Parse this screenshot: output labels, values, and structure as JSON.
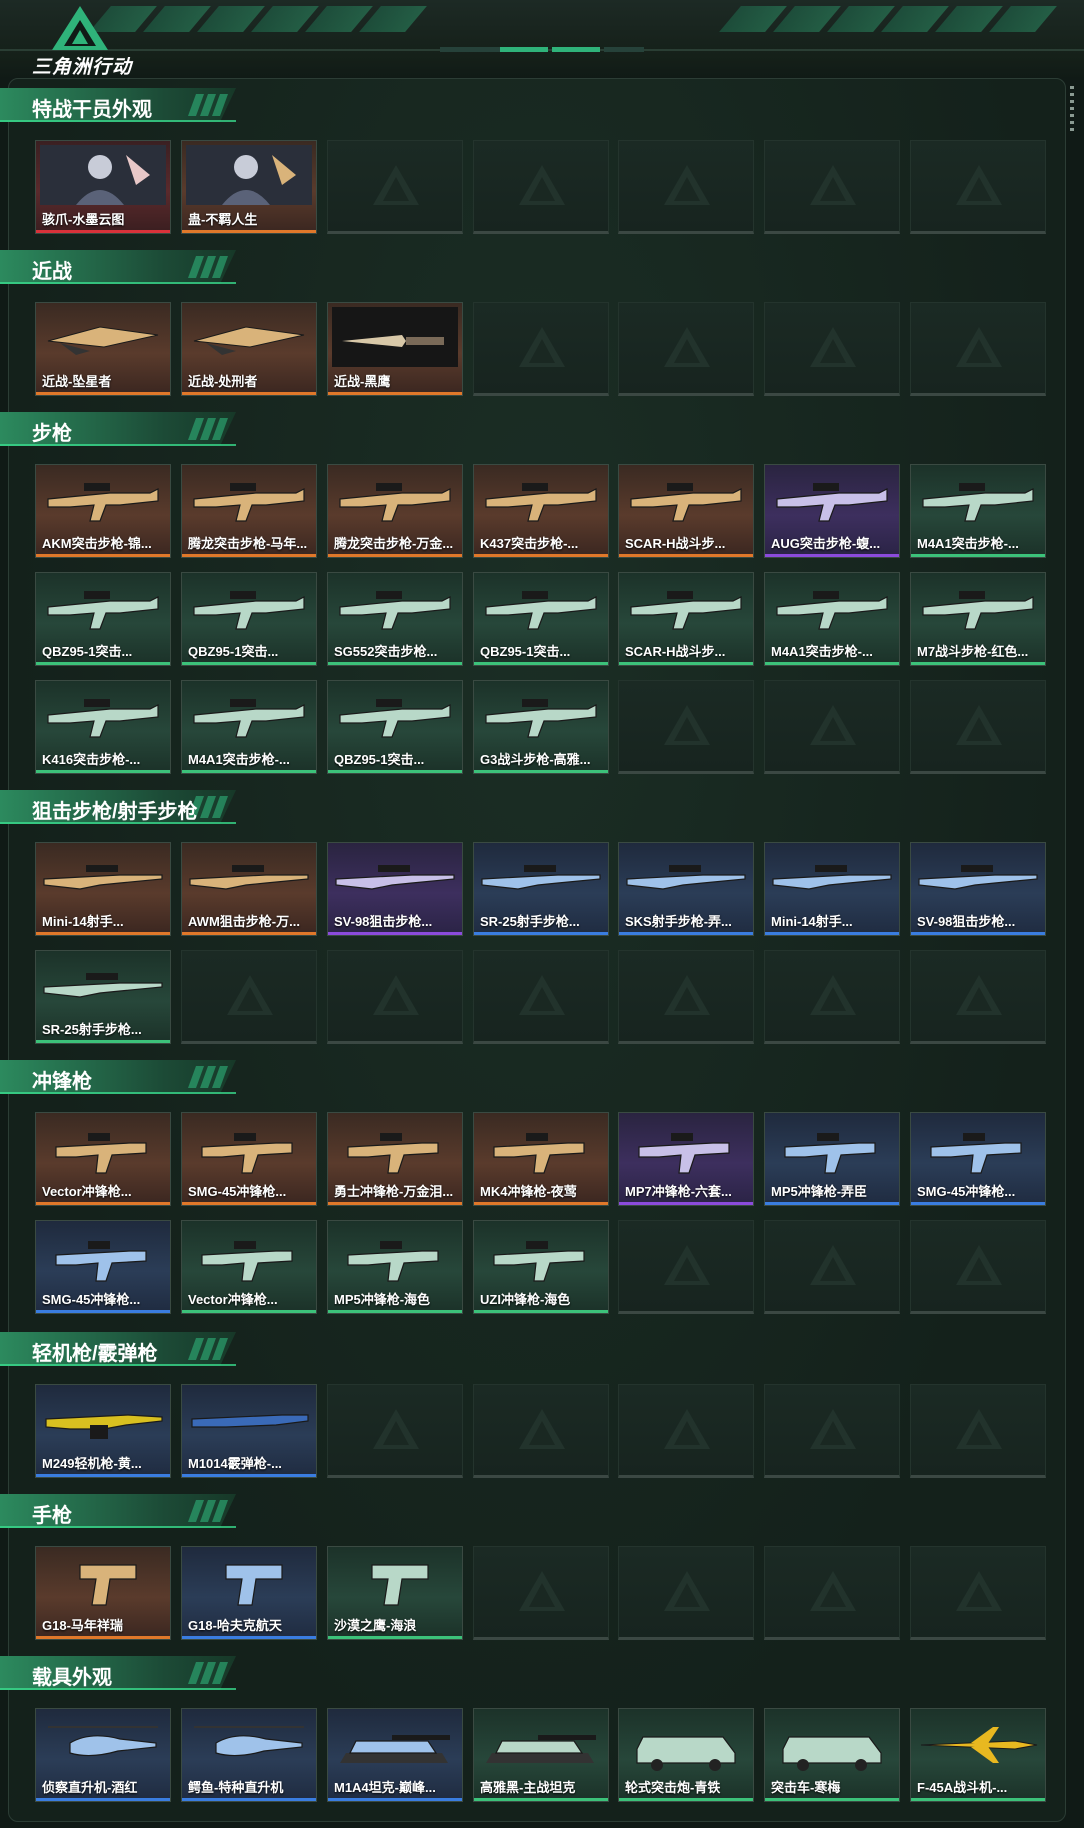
{
  "app": {
    "logo_text": "三角洲行动"
  },
  "colors": {
    "accent": "#2fb37a",
    "orange": "#e0782a",
    "purple": "#8b4bdc",
    "blue": "#3a7de0",
    "green": "#3cc27a",
    "red": "#d8323a"
  },
  "sections": [
    {
      "title": "特战干员外观",
      "items": [
        {
          "label": "骇爪-水墨云图",
          "rarity": "red",
          "icon": "operator-portrait"
        },
        {
          "label": "蛊-不羁人生",
          "rarity": "orange",
          "icon": "operator-portrait"
        }
      ]
    },
    {
      "title": "近战",
      "items": [
        {
          "label": "近战-坠星者",
          "rarity": "orange",
          "icon": "melee-blade"
        },
        {
          "label": "近战-处刑者",
          "rarity": "orange",
          "icon": "melee-blade"
        },
        {
          "label": "近战-黑鹰",
          "rarity": "orange",
          "icon": "melee-knife"
        }
      ]
    },
    {
      "title": "步枪",
      "items": [
        {
          "label": "AKM突击步枪-锦...",
          "rarity": "orange",
          "icon": "rifle"
        },
        {
          "label": "腾龙突击步枪-马年...",
          "rarity": "orange",
          "icon": "rifle"
        },
        {
          "label": "腾龙突击步枪-万金...",
          "rarity": "orange",
          "icon": "rifle"
        },
        {
          "label": "K437突击步枪-...",
          "rarity": "orange",
          "icon": "rifle"
        },
        {
          "label": "SCAR-H战斗步...",
          "rarity": "orange",
          "icon": "rifle"
        },
        {
          "label": "AUG突击步枪-蝮...",
          "rarity": "purple",
          "icon": "rifle"
        },
        {
          "label": "M4A1突击步枪-...",
          "rarity": "green",
          "icon": "rifle"
        },
        {
          "label": "QBZ95-1突击...",
          "rarity": "green",
          "icon": "rifle"
        },
        {
          "label": "QBZ95-1突击...",
          "rarity": "green",
          "icon": "rifle"
        },
        {
          "label": "SG552突击步枪...",
          "rarity": "green",
          "icon": "rifle"
        },
        {
          "label": "QBZ95-1突击...",
          "rarity": "green",
          "icon": "rifle"
        },
        {
          "label": "SCAR-H战斗步...",
          "rarity": "green",
          "icon": "rifle"
        },
        {
          "label": "M4A1突击步枪-...",
          "rarity": "green",
          "icon": "rifle"
        },
        {
          "label": "M7战斗步枪-红色...",
          "rarity": "green",
          "icon": "rifle"
        },
        {
          "label": "K416突击步枪-...",
          "rarity": "green",
          "icon": "rifle"
        },
        {
          "label": "M4A1突击步枪-...",
          "rarity": "green",
          "icon": "rifle"
        },
        {
          "label": "QBZ95-1突击...",
          "rarity": "green",
          "icon": "rifle"
        },
        {
          "label": "G3战斗步枪-高雅...",
          "rarity": "green",
          "icon": "rifle"
        }
      ]
    },
    {
      "title": "狙击步枪/射手步枪",
      "items": [
        {
          "label": "Mini-14射手...",
          "rarity": "orange",
          "icon": "sniper"
        },
        {
          "label": "AWM狙击步枪-万...",
          "rarity": "orange",
          "icon": "sniper"
        },
        {
          "label": "SV-98狙击步枪...",
          "rarity": "purple",
          "icon": "sniper"
        },
        {
          "label": "SR-25射手步枪...",
          "rarity": "blue",
          "icon": "sniper"
        },
        {
          "label": "SKS射手步枪-弄...",
          "rarity": "blue",
          "icon": "sniper"
        },
        {
          "label": "Mini-14射手...",
          "rarity": "blue",
          "icon": "sniper"
        },
        {
          "label": "SV-98狙击步枪...",
          "rarity": "blue",
          "icon": "sniper"
        },
        {
          "label": "SR-25射手步枪...",
          "rarity": "green",
          "icon": "sniper"
        }
      ]
    },
    {
      "title": "冲锋枪",
      "items": [
        {
          "label": "Vector冲锋枪...",
          "rarity": "orange",
          "icon": "smg"
        },
        {
          "label": "SMG-45冲锋枪...",
          "rarity": "orange",
          "icon": "smg"
        },
        {
          "label": "勇士冲锋枪-万金泪...",
          "rarity": "orange",
          "icon": "smg"
        },
        {
          "label": "MK4冲锋枪-夜莺",
          "rarity": "orange",
          "icon": "smg"
        },
        {
          "label": "MP7冲锋枪-六套...",
          "rarity": "purple",
          "icon": "smg"
        },
        {
          "label": "MP5冲锋枪-弄臣",
          "rarity": "blue",
          "icon": "smg"
        },
        {
          "label": "SMG-45冲锋枪...",
          "rarity": "blue",
          "icon": "smg"
        },
        {
          "label": "SMG-45冲锋枪...",
          "rarity": "blue",
          "icon": "smg"
        },
        {
          "label": "Vector冲锋枪...",
          "rarity": "green",
          "icon": "smg"
        },
        {
          "label": "MP5冲锋枪-海色",
          "rarity": "green",
          "icon": "smg"
        },
        {
          "label": "UZI冲锋枪-海色",
          "rarity": "green",
          "icon": "smg"
        }
      ]
    },
    {
      "title": "轻机枪/霰弹枪",
      "items": [
        {
          "label": "M249轻机枪-黄...",
          "rarity": "blue",
          "icon": "lmg"
        },
        {
          "label": "M1014霰弹枪-...",
          "rarity": "blue",
          "icon": "shotgun"
        }
      ]
    },
    {
      "title": "手枪",
      "items": [
        {
          "label": "G18-马年祥瑞",
          "rarity": "orange",
          "icon": "pistol"
        },
        {
          "label": "G18-哈夫克航天",
          "rarity": "blue",
          "icon": "pistol"
        },
        {
          "label": "沙漠之鹰-海浪",
          "rarity": "green",
          "icon": "pistol"
        }
      ]
    },
    {
      "title": "载具外观",
      "items": [
        {
          "label": "侦察直升机-酒红",
          "rarity": "blue",
          "icon": "helicopter"
        },
        {
          "label": "鳄鱼-特种直升机",
          "rarity": "blue",
          "icon": "helicopter"
        },
        {
          "label": "M1A4坦克-巅峰...",
          "rarity": "blue",
          "icon": "tank"
        },
        {
          "label": "高雅黑-主战坦克",
          "rarity": "green",
          "icon": "tank"
        },
        {
          "label": "轮式突击炮-青铁",
          "rarity": "green",
          "icon": "armored-vehicle"
        },
        {
          "label": "突击车-寒梅",
          "rarity": "green",
          "icon": "armored-vehicle"
        },
        {
          "label": "F-45A战斗机-...",
          "rarity": "green",
          "icon": "jet"
        }
      ]
    }
  ]
}
